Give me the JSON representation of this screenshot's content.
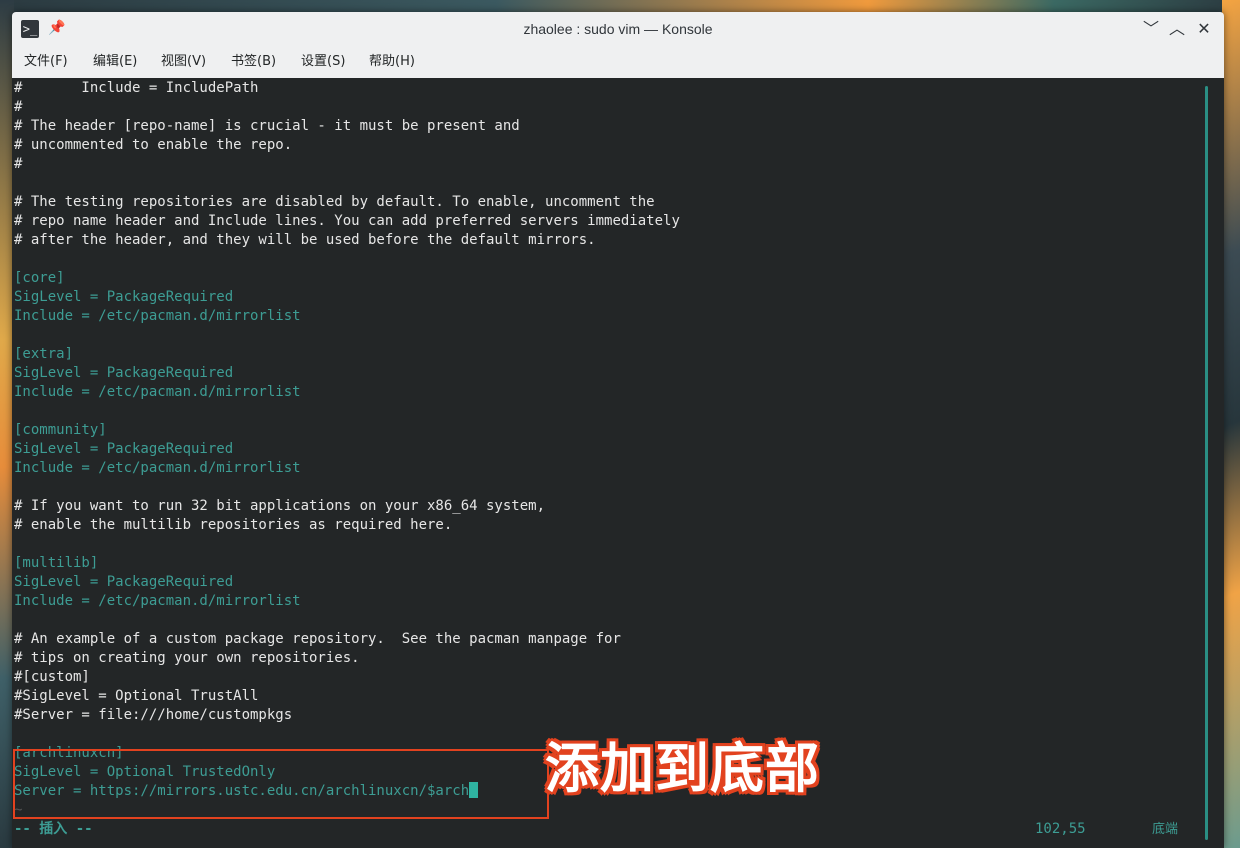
{
  "window": {
    "title": "zhaolee : sudo vim — Konsole",
    "app_icon": "terminal-icon",
    "app_icon_glyph": ">_",
    "pin_icon": "pin-icon",
    "buttons": {
      "minimize": "﹀",
      "maximize": "︿",
      "close": "✕"
    }
  },
  "menu": {
    "items": [
      {
        "label": "文件(F)"
      },
      {
        "label": "编辑(E)"
      },
      {
        "label": "视图(V)"
      },
      {
        "label": "书签(B)"
      },
      {
        "label": "设置(S)"
      },
      {
        "label": "帮助(H)"
      }
    ]
  },
  "editor": {
    "lines": [
      {
        "text": "#       Include = IncludePath",
        "style": "plain"
      },
      {
        "text": "#",
        "style": "plain"
      },
      {
        "text": "# The header [repo-name] is crucial - it must be present and",
        "style": "plain"
      },
      {
        "text": "# uncommented to enable the repo.",
        "style": "plain"
      },
      {
        "text": "#",
        "style": "plain"
      },
      {
        "text": "",
        "style": "plain"
      },
      {
        "text": "# The testing repositories are disabled by default. To enable, uncomment the",
        "style": "plain"
      },
      {
        "text": "# repo name header and Include lines. You can add preferred servers immediately",
        "style": "plain"
      },
      {
        "text": "# after the header, and they will be used before the default mirrors.",
        "style": "plain"
      },
      {
        "text": "",
        "style": "plain"
      },
      {
        "text": "[core]",
        "style": "cyan"
      },
      {
        "text": "SigLevel = PackageRequired",
        "style": "cyan"
      },
      {
        "text": "Include = /etc/pacman.d/mirrorlist",
        "style": "cyan"
      },
      {
        "text": "",
        "style": "plain"
      },
      {
        "text": "[extra]",
        "style": "cyan"
      },
      {
        "text": "SigLevel = PackageRequired",
        "style": "cyan"
      },
      {
        "text": "Include = /etc/pacman.d/mirrorlist",
        "style": "cyan"
      },
      {
        "text": "",
        "style": "plain"
      },
      {
        "text": "[community]",
        "style": "cyan"
      },
      {
        "text": "SigLevel = PackageRequired",
        "style": "cyan"
      },
      {
        "text": "Include = /etc/pacman.d/mirrorlist",
        "style": "cyan"
      },
      {
        "text": "",
        "style": "plain"
      },
      {
        "text": "# If you want to run 32 bit applications on your x86_64 system,",
        "style": "plain"
      },
      {
        "text": "# enable the multilib repositories as required here.",
        "style": "plain"
      },
      {
        "text": "",
        "style": "plain"
      },
      {
        "text": "[multilib]",
        "style": "cyan"
      },
      {
        "text": "SigLevel = PackageRequired",
        "style": "cyan"
      },
      {
        "text": "Include = /etc/pacman.d/mirrorlist",
        "style": "cyan"
      },
      {
        "text": "",
        "style": "plain"
      },
      {
        "text": "# An example of a custom package repository.  See the pacman manpage for",
        "style": "plain"
      },
      {
        "text": "# tips on creating your own repositories.",
        "style": "plain"
      },
      {
        "text": "#[custom]",
        "style": "plain"
      },
      {
        "text": "#SigLevel = Optional TrustAll",
        "style": "plain"
      },
      {
        "text": "#Server = file:///home/custompkgs",
        "style": "plain"
      },
      {
        "text": "",
        "style": "plain"
      },
      {
        "text": "[archlinuxcn]",
        "style": "cyan"
      },
      {
        "text": "SigLevel = Optional TrustedOnly",
        "style": "cyan"
      },
      {
        "text": "Server = https://mirrors.ustc.edu.cn/archlinuxcn/$arch",
        "style": "cyan",
        "cursor": true
      },
      {
        "text": "~",
        "style": "tilde"
      }
    ],
    "status": {
      "mode": "-- 插入 --",
      "position": "102,55",
      "scroll": "底端"
    },
    "colors": {
      "background": "#232627",
      "text": "#e6e6e6",
      "accent": "#3d9d94",
      "cursor": "#2fb3a1"
    }
  },
  "annotation": {
    "text": "添加到底部",
    "color": "#e2421f"
  }
}
